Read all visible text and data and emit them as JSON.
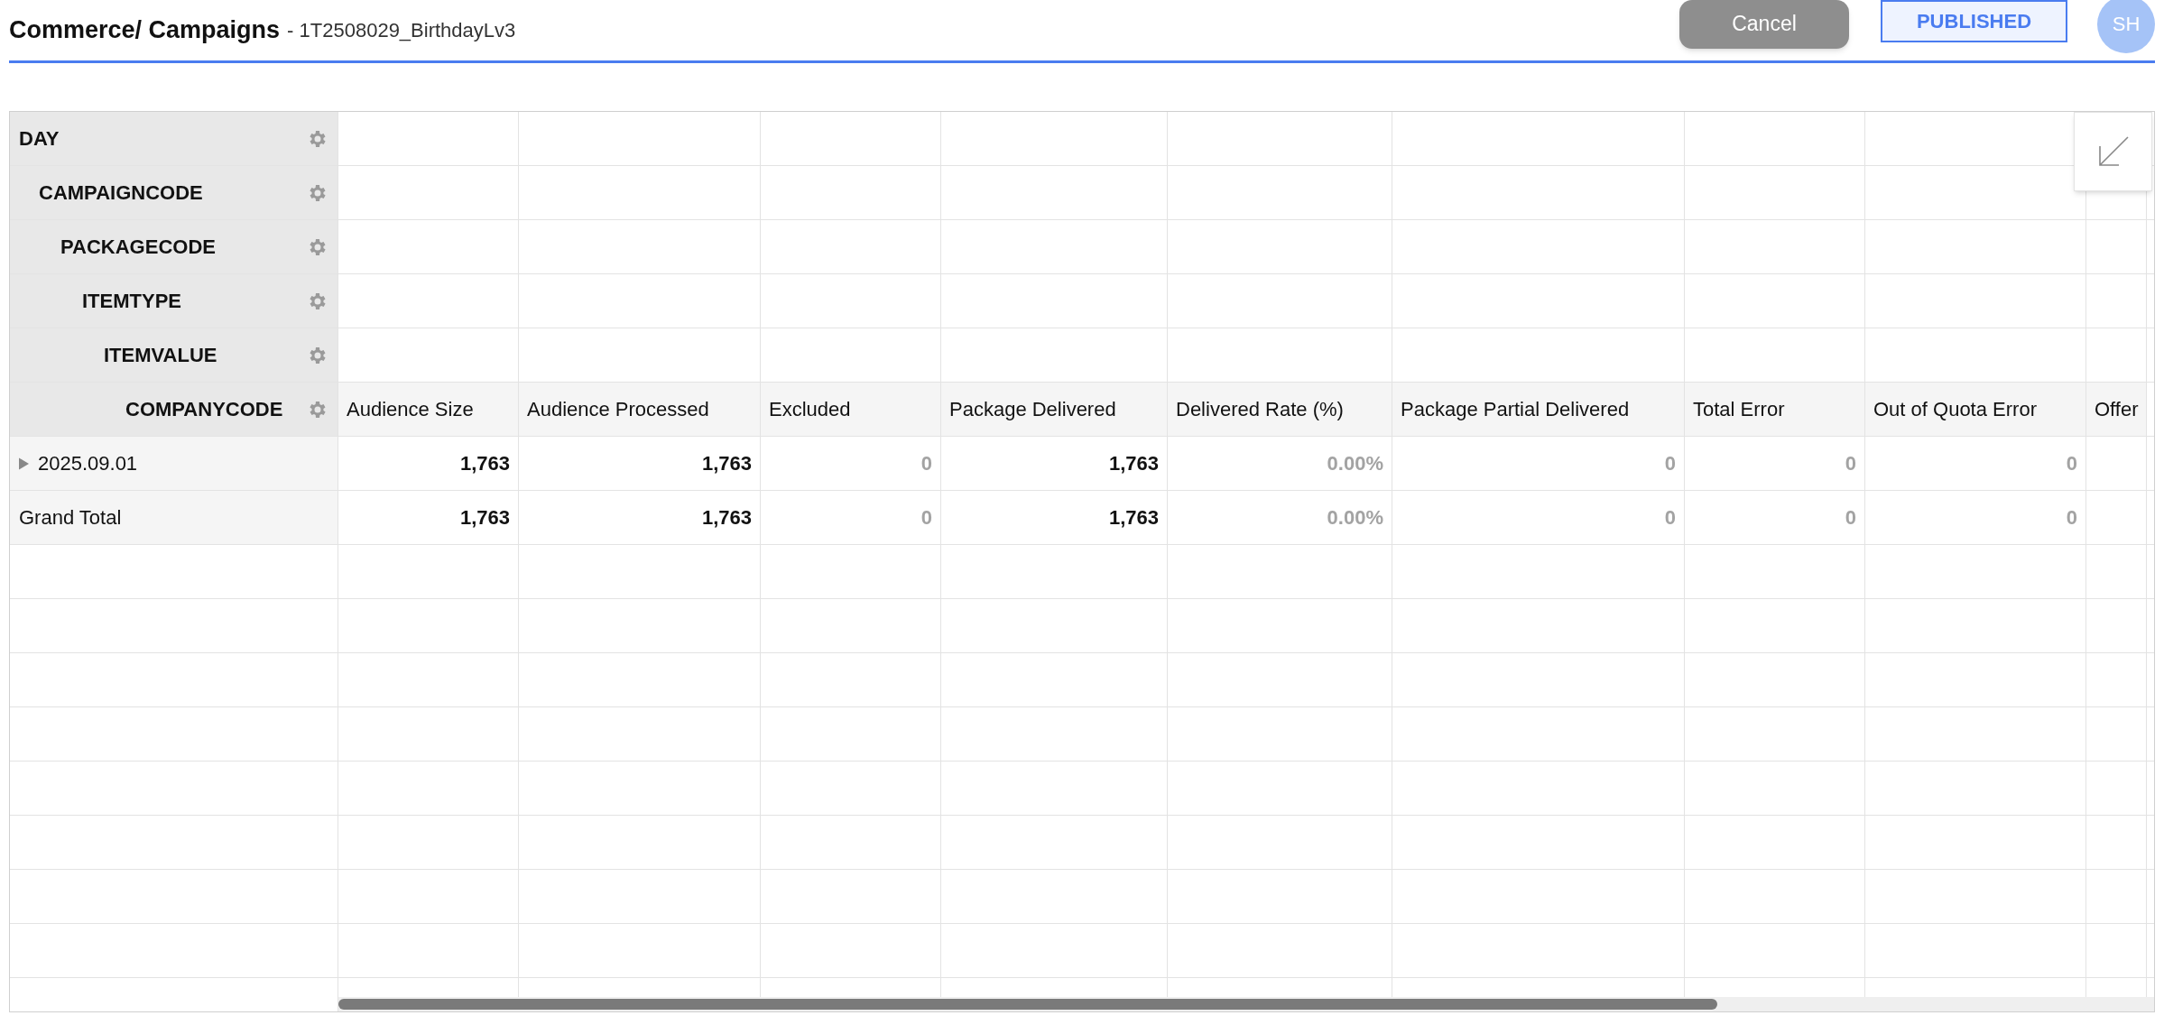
{
  "header": {
    "breadcrumb": "Commerce/ Campaigns",
    "subtitle": "- 1T2508029_BirthdayLv3",
    "cancel_button": "Cancel",
    "status_button": "PUBLISHED",
    "avatar": "SH"
  },
  "pivot": {
    "row_fields": [
      "DAY",
      "CAMPAIGNCODE",
      "PACKAGECODE",
      "ITEMTYPE",
      "ITEMVALUE",
      "COMPANYCODE"
    ],
    "columns": [
      "Audience Size",
      "Audience Processed",
      "Excluded",
      "Package Delivered",
      "Delivered Rate (%)",
      "Package Partial Delivered",
      "Total Error",
      "Out of Quota Error",
      "Offer"
    ],
    "rows": [
      {
        "label": "2025.09.01",
        "expandable": true,
        "cells": [
          {
            "text": "1,763",
            "muted": false
          },
          {
            "text": "1,763",
            "muted": false
          },
          {
            "text": "0",
            "muted": true
          },
          {
            "text": "1,763",
            "muted": false
          },
          {
            "text": "0.00%",
            "muted": true
          },
          {
            "text": "0",
            "muted": true
          },
          {
            "text": "0",
            "muted": true
          },
          {
            "text": "0",
            "muted": true
          }
        ]
      },
      {
        "label": "Grand Total",
        "expandable": false,
        "cells": [
          {
            "text": "1,763",
            "muted": false
          },
          {
            "text": "1,763",
            "muted": false
          },
          {
            "text": "0",
            "muted": true
          },
          {
            "text": "1,763",
            "muted": false
          },
          {
            "text": "0.00%",
            "muted": true
          },
          {
            "text": "0",
            "muted": true
          },
          {
            "text": "0",
            "muted": true
          },
          {
            "text": "0",
            "muted": true
          }
        ]
      }
    ]
  }
}
